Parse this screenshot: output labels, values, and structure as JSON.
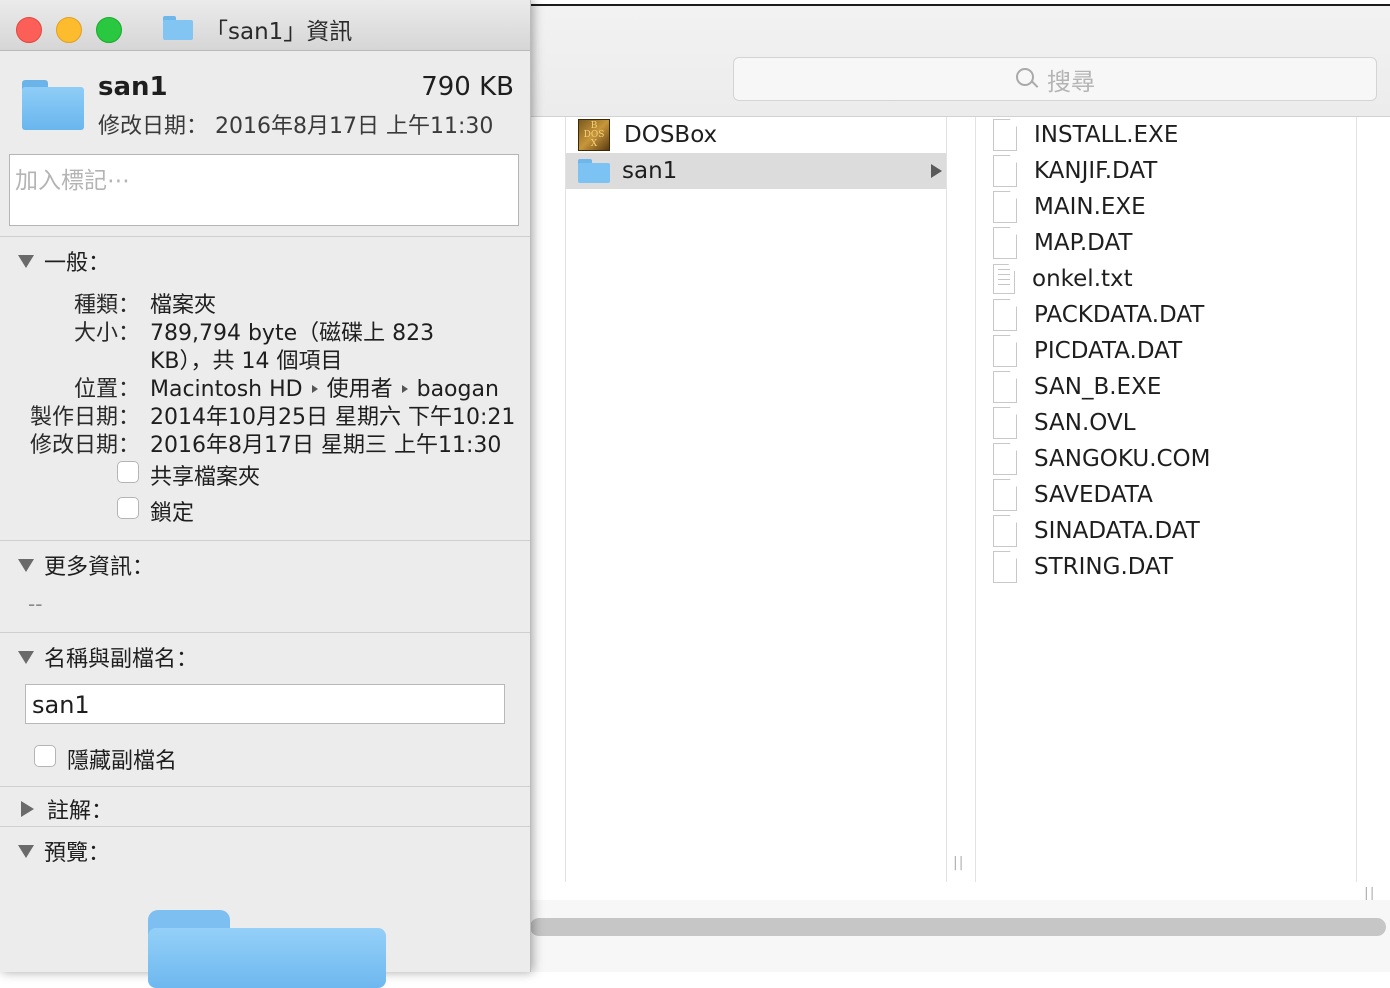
{
  "finder": {
    "search_placeholder": "搜尋",
    "column1": [
      {
        "name": "DOSBox",
        "icon": "dosbox-app-icon",
        "selected": false
      },
      {
        "name": "san1",
        "icon": "folder-icon",
        "selected": true
      }
    ],
    "column2": [
      {
        "name": "INSTALL.EXE",
        "icon": "document-icon"
      },
      {
        "name": "KANJIF.DAT",
        "icon": "document-icon"
      },
      {
        "name": "MAIN.EXE",
        "icon": "document-icon"
      },
      {
        "name": "MAP.DAT",
        "icon": "document-icon"
      },
      {
        "name": "onkel.txt",
        "icon": "text-document-icon"
      },
      {
        "name": "PACKDATA.DAT",
        "icon": "document-icon"
      },
      {
        "name": "PICDATA.DAT",
        "icon": "document-icon"
      },
      {
        "name": "SAN_B.EXE",
        "icon": "document-icon"
      },
      {
        "name": "SAN.OVL",
        "icon": "document-icon"
      },
      {
        "name": "SANGOKU.COM",
        "icon": "document-icon"
      },
      {
        "name": "SAVEDATA",
        "icon": "document-icon"
      },
      {
        "name": "SINADATA.DAT",
        "icon": "document-icon"
      },
      {
        "name": "STRING.DAT",
        "icon": "document-icon"
      }
    ],
    "column_resize_mark": "||"
  },
  "info": {
    "window_title": "「san1」資訊",
    "name": "san1",
    "size": "790 KB",
    "modified_summary": "修改日期： 2016年8月17日 上午11:30",
    "tags_placeholder": "加入標記⋯",
    "general": {
      "header": "一般：",
      "kind_label": "種類：",
      "kind_value": "檔案夾",
      "size_label": "大小：",
      "size_value_line1": "789,794 byte（磁碟上 823",
      "size_value_line2": "KB），共 14 個項目",
      "where_label": "位置：",
      "where_path": [
        "Macintosh HD",
        "使用者",
        "baogan"
      ],
      "created_label": "製作日期：",
      "created_value": "2014年10月25日 星期六 下午10:21",
      "modified_label": "修改日期：",
      "modified_value": "2016年8月17日 星期三 上午11:30",
      "shared_folder_label": "共享檔案夾",
      "locked_label": "鎖定"
    },
    "more_info": {
      "header": "更多資訊：",
      "value": "--"
    },
    "name_ext": {
      "header": "名稱與副檔名：",
      "name_value": "san1",
      "hide_ext_label": "隱藏副檔名"
    },
    "comments": {
      "header": "註解："
    },
    "preview": {
      "header": "預覽："
    }
  },
  "colors": {
    "close": "#fc5f57",
    "minimize": "#fdbc2e",
    "zoom": "#29c840",
    "folder": "#7cc2f2",
    "selection": "#dcdcdc"
  }
}
